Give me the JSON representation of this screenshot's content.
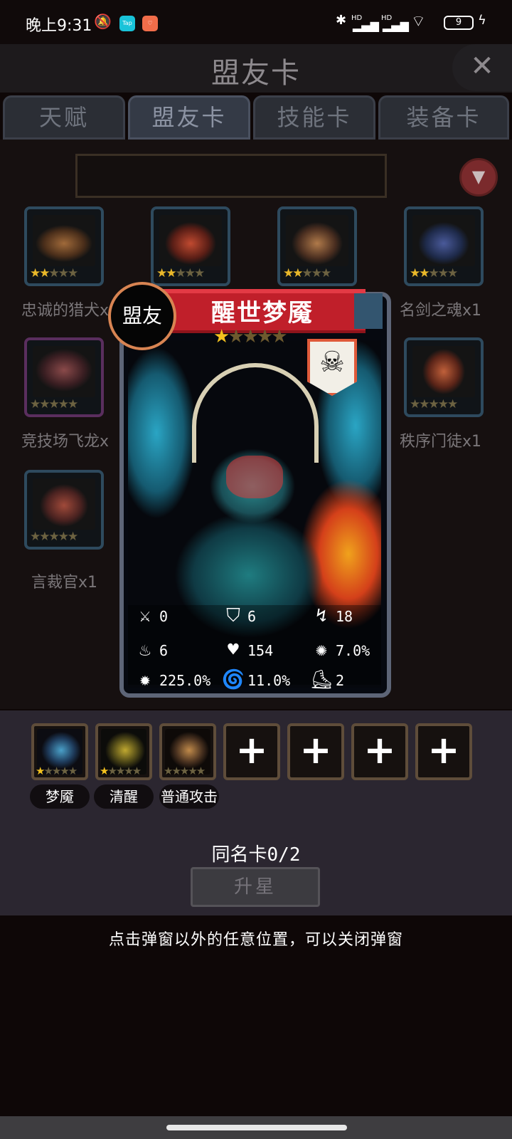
{
  "status_bar": {
    "time": "晚上9:31",
    "mute_icon": "bell-off-icon",
    "apps": [
      {
        "label": "Tap",
        "color": "#19c3d9"
      },
      {
        "label": "♡",
        "color": "#f16d4a"
      }
    ],
    "network": "HD",
    "battery": "9",
    "charging_icon": "bolt-icon"
  },
  "header": {
    "title": "盟友卡",
    "close_icon": "close-icon"
  },
  "tabs": [
    {
      "label": "天赋",
      "active": false
    },
    {
      "label": "盟友卡",
      "active": true
    },
    {
      "label": "技能卡",
      "active": false
    },
    {
      "label": "装备卡",
      "active": false
    }
  ],
  "search": {
    "value": "",
    "filter_icon": "filter-icon"
  },
  "grid": [
    {
      "name": "忠诚的猎犬x1",
      "stars": 2,
      "border": "#2e4a5e",
      "art": "#5b3a22"
    },
    {
      "name": "",
      "stars": 2,
      "border": "#2e4a5e",
      "art": "#7a2a20"
    },
    {
      "name": "",
      "stars": 2,
      "border": "#2e4a5e",
      "art": "#6b4a30"
    },
    {
      "name": "名剑之魂x1",
      "stars": 2,
      "border": "#2e4a5e",
      "art": "#2a3a66"
    },
    {
      "name": "竞技场飞龙x",
      "stars": 0,
      "border": "#5a2e5e",
      "art": "#4a2a30"
    },
    {
      "name": "秩序门徒x1",
      "stars": 0,
      "border": "#2e4a5e",
      "art": "#7a3a2a"
    },
    {
      "name": "言裁官x1",
      "stars": 0,
      "border": "#2e4a5e",
      "art": "#5a3430"
    }
  ],
  "popup": {
    "tag": "盟友",
    "name": "醒世梦魇",
    "stars": 1,
    "max_stars": 5,
    "class_icon": "skull-icon",
    "stats": [
      {
        "icon": "sword-icon",
        "glyph": "⚔",
        "value": "0"
      },
      {
        "icon": "shield-icon",
        "glyph": "⛉",
        "value": "6"
      },
      {
        "icon": "dodge-icon",
        "glyph": "↯",
        "value": "18"
      },
      {
        "icon": "flame-icon",
        "glyph": "♨",
        "value": "6"
      },
      {
        "icon": "heart-icon",
        "glyph": "♥",
        "value": "154"
      },
      {
        "icon": "burst-icon",
        "glyph": "✺",
        "value": "7.0%"
      },
      {
        "icon": "crit-icon",
        "glyph": "✹",
        "value": "225.0%"
      },
      {
        "icon": "whirlwind-icon",
        "glyph": "🌀",
        "value": "11.0%"
      },
      {
        "icon": "boot-icon",
        "glyph": "⛸",
        "value": "2"
      }
    ]
  },
  "skills": [
    {
      "label": "梦魇",
      "stars": 1,
      "art": "#2a4f6a"
    },
    {
      "label": "清醒",
      "stars": 1,
      "art": "#5a5a22"
    },
    {
      "label": "普通攻击",
      "stars": 0,
      "art": "#6a4a2a"
    }
  ],
  "empty_slots": [
    "+",
    "+",
    "+",
    "+"
  ],
  "same_card": "同名卡0/2",
  "upgrade_button": "升星",
  "hint": "点击弹窗以外的任意位置，可以关闭弹窗"
}
